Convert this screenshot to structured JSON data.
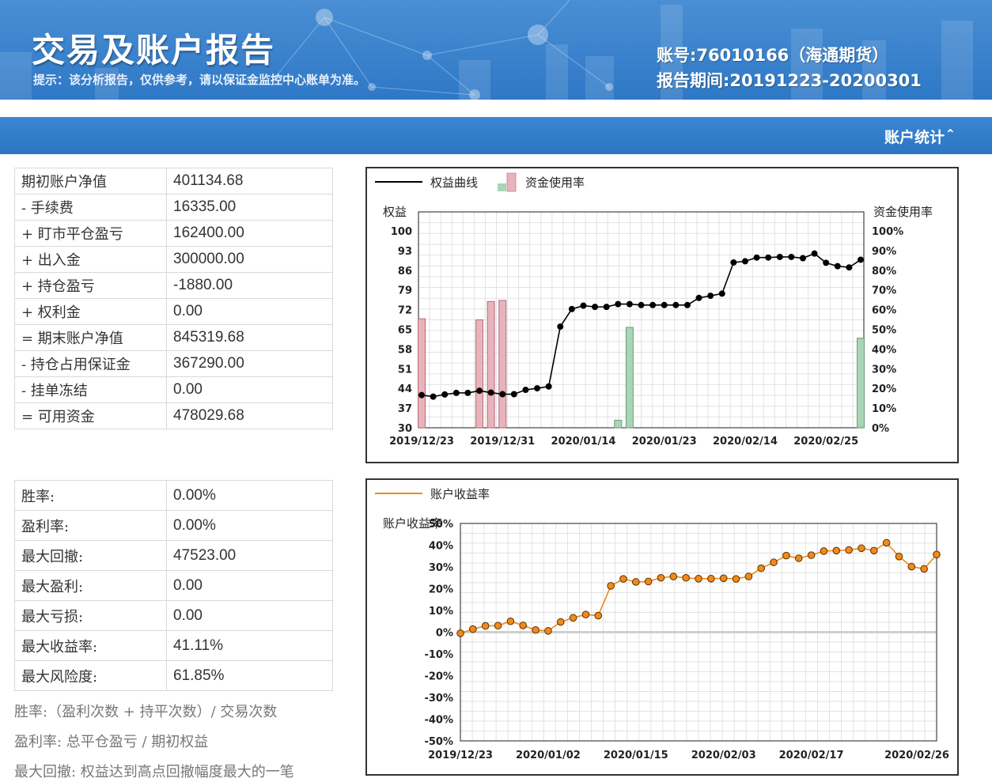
{
  "header": {
    "title": "交易及账户报告",
    "tip": "提示：该分析报告，仅供参考，请以保证金监控中心账单为准。",
    "account": "账号:76010166（海通期货）",
    "period": "报告期间:20191223-20200301"
  },
  "section": {
    "title": "账户统计"
  },
  "account_table": [
    {
      "label": "期初账户净值",
      "value": "401134.68"
    },
    {
      "label": "- 手续费",
      "value": "16335.00"
    },
    {
      "label": "+ 盯市平仓盈亏",
      "value": "162400.00"
    },
    {
      "label": "+ 出入金",
      "value": "300000.00"
    },
    {
      "label": "+ 持仓盈亏",
      "value": "-1880.00"
    },
    {
      "label": "+ 权利金",
      "value": "0.00"
    },
    {
      "label": "= 期末账户净值",
      "value": "845319.68"
    },
    {
      "label": "- 持仓占用保证金",
      "value": "367290.00"
    },
    {
      "label": "- 挂单冻结",
      "value": "0.00"
    },
    {
      "label": "= 可用资金",
      "value": "478029.68"
    }
  ],
  "ratio_table": [
    {
      "label": "胜率:",
      "value": "0.00%"
    },
    {
      "label": "盈利率:",
      "value": "0.00%"
    },
    {
      "label": "最大回撤:",
      "value": "47523.00"
    },
    {
      "label": "最大盈利:",
      "value": "0.00"
    },
    {
      "label": "最大亏损:",
      "value": "0.00"
    },
    {
      "label": "最大收益率:",
      "value": "41.11%"
    },
    {
      "label": "最大风险度:",
      "value": "61.85%"
    }
  ],
  "notes": [
    "胜率:（盈利次数 + 持平次数）/ 交易次数",
    "盈利率: 总平仓盈亏 / 期初权益",
    "最大回撤: 权益达到高点回撤幅度最大的一笔"
  ],
  "colors": {
    "banner": "#2e78c6",
    "equity_line": "#000000",
    "usage_bar_red": "#e8b4bc",
    "usage_bar_green": "#a8d5b5",
    "return_line": "#f08a1c"
  },
  "chart_data": [
    {
      "type": "line",
      "legend": [
        "权益曲线",
        "资金使用率"
      ],
      "legend_placement": "top-left",
      "ylabel": "权益",
      "ylabel_right": "资金使用率",
      "grid": true,
      "x_ticks": [
        "2019/12/23",
        "2019/12/31",
        "2020/01/14",
        "2020/01/23",
        "2020/02/14",
        "2020/02/25"
      ],
      "y_ticks": [
        "100",
        "93",
        "86",
        "79",
        "72",
        "65",
        "58",
        "51",
        "44",
        "37",
        "30"
      ],
      "y_ticks_right": [
        "100%",
        "90%",
        "80%",
        "70%",
        "60%",
        "50%",
        "40%",
        "30%",
        "20%",
        "10%",
        "0%"
      ],
      "ylim": [
        30,
        100
      ],
      "ylim_right": [
        0,
        100
      ],
      "series": [
        {
          "name": "权益曲线",
          "values": [
            40.6,
            40.1,
            40.8,
            41.3,
            41.3,
            42.0,
            41.4,
            40.9,
            40.9,
            42.3,
            42.8,
            43.4,
            62.8,
            68.5,
            69.6,
            69.2,
            69.2,
            70.1,
            70.1,
            69.8,
            69.8,
            69.8,
            69.8,
            69.8,
            72.1,
            72.8,
            73.5,
            83.6,
            84.0,
            85.2,
            85.2,
            85.4,
            85.4,
            85.0,
            86.5,
            83.5,
            82.4,
            82.0,
            84.5
          ]
        },
        {
          "name": "资金使用率",
          "type": "bar",
          "bars": [
            {
              "index": 0,
              "value": 50.5,
              "color": "red"
            },
            {
              "index": 5,
              "value": 50.0,
              "color": "red"
            },
            {
              "index": 6,
              "value": 58.5,
              "color": "red"
            },
            {
              "index": 7,
              "value": 59.0,
              "color": "red"
            },
            {
              "index": 17,
              "value": 3.5,
              "color": "green"
            },
            {
              "index": 18,
              "value": 46.5,
              "color": "green"
            },
            {
              "index": 38,
              "value": 41.5,
              "color": "green"
            }
          ]
        }
      ]
    },
    {
      "type": "line",
      "legend": [
        "账户收益率"
      ],
      "legend_placement": "top-left",
      "ylabel": "账户收益率",
      "grid": true,
      "x_ticks": [
        "2019/12/23",
        "2020/01/02",
        "2020/01/15",
        "2020/02/03",
        "2020/02/17",
        "2020/02/26"
      ],
      "y_ticks": [
        "50%",
        "40%",
        "30%",
        "20%",
        "10%",
        "0%",
        "-10%",
        "-20%",
        "-30%",
        "-40%",
        "-50%"
      ],
      "ylim": [
        -50,
        50
      ],
      "series": [
        {
          "name": "账户收益率",
          "values": [
            -0.5,
            1.4,
            2.9,
            3.0,
            5.0,
            3.1,
            1.0,
            0.6,
            4.7,
            6.6,
            8.1,
            7.6,
            21.3,
            24.5,
            23.1,
            23.3,
            25.0,
            25.6,
            25.0,
            24.6,
            24.6,
            24.8,
            24.5,
            25.6,
            29.4,
            32.1,
            35.2,
            34.0,
            35.4,
            37.3,
            37.5,
            37.8,
            38.6,
            37.5,
            41.1,
            34.8,
            30.1,
            29.1,
            35.7
          ]
        }
      ]
    }
  ]
}
